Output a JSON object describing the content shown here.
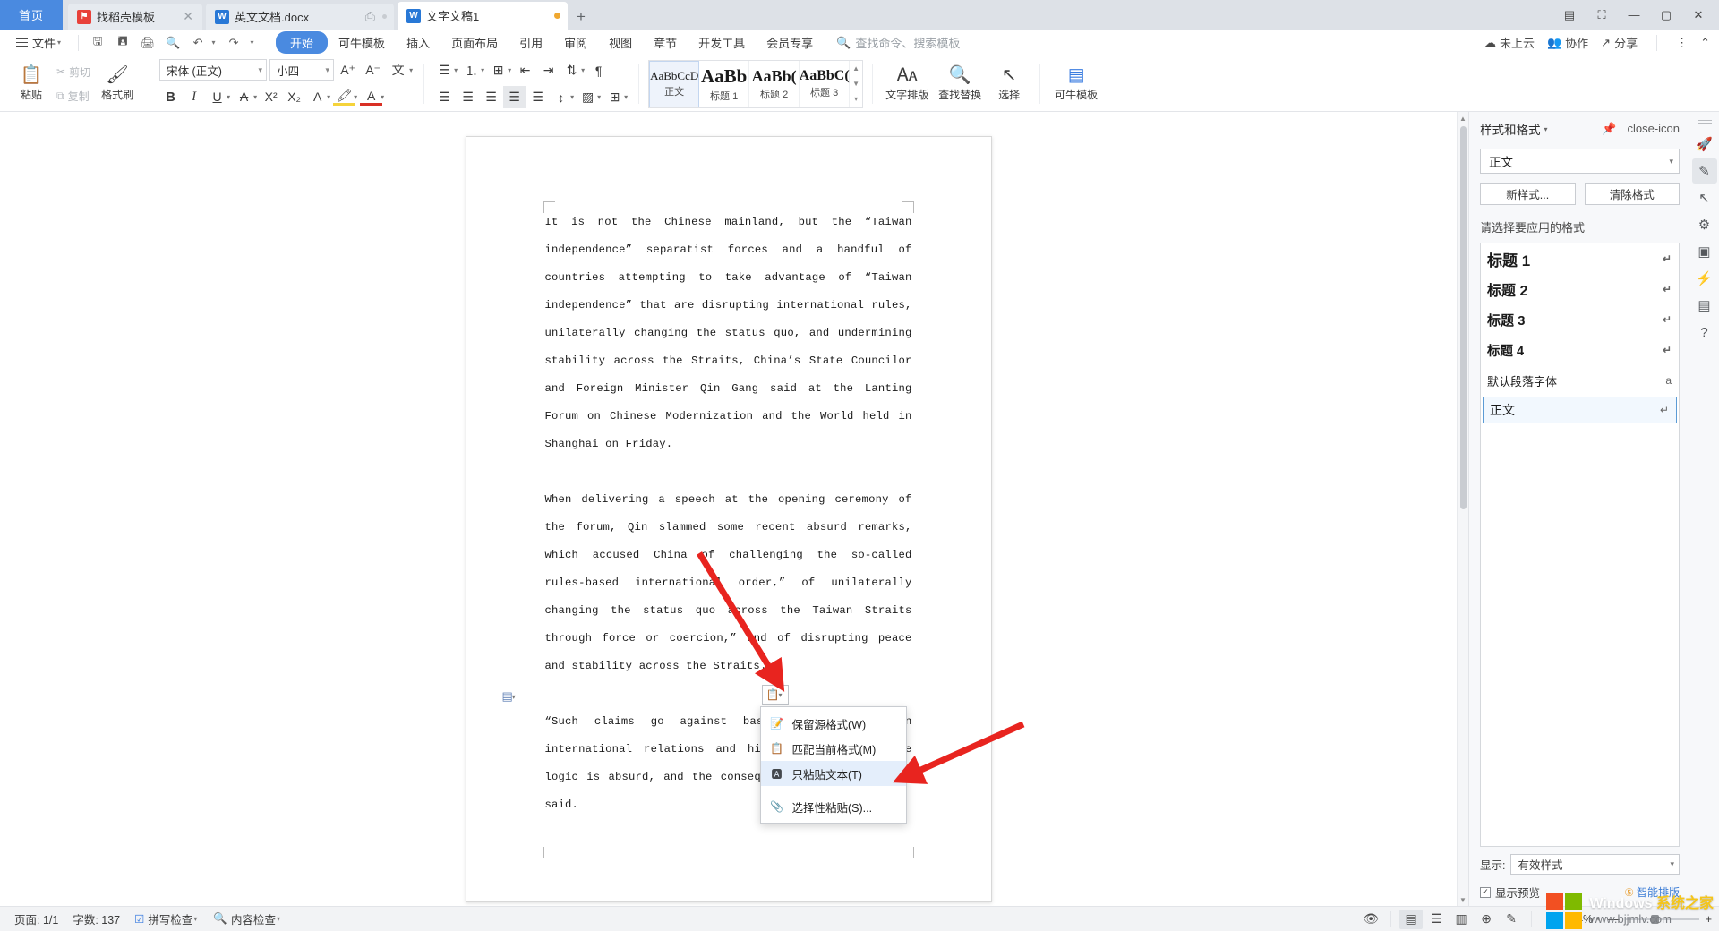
{
  "tabbar": {
    "home_label": "首页",
    "tabs": [
      {
        "label": "找稻壳模板",
        "icon": "kdocs-template-icon",
        "state": "inactive",
        "close": "✕"
      },
      {
        "label": "英文文档.docx",
        "icon": "writer-doc-icon",
        "state": "inactive",
        "close": ""
      },
      {
        "label": "文字文稿1",
        "icon": "writer-doc-icon",
        "state": "active",
        "close": ""
      }
    ],
    "new_tab": "+",
    "window_buttons": [
      "▭",
      "▱",
      "—",
      "▢",
      "✕"
    ]
  },
  "menubar": {
    "file_label": "文件",
    "quick_icons": [
      "save-icon",
      "save-as-icon",
      "print-icon",
      "print-preview-icon",
      "undo-icon",
      "redo-icon",
      "customize-icon"
    ],
    "ribbon_tabs": [
      {
        "label": "开始",
        "active": true
      },
      {
        "label": "可牛模板",
        "active": false
      },
      {
        "label": "插入",
        "active": false
      },
      {
        "label": "页面布局",
        "active": false
      },
      {
        "label": "引用",
        "active": false
      },
      {
        "label": "审阅",
        "active": false
      },
      {
        "label": "视图",
        "active": false
      },
      {
        "label": "章节",
        "active": false
      },
      {
        "label": "开发工具",
        "active": false
      },
      {
        "label": "会员专享",
        "active": false
      }
    ],
    "search_placeholder": "查找命令、搜索模板",
    "right_items": [
      {
        "label": "未上云",
        "icon": "cloud-off-icon"
      },
      {
        "label": "协作",
        "icon": "collaborate-icon"
      },
      {
        "label": "分享",
        "icon": "share-icon"
      }
    ],
    "more_icon": "⋮",
    "collapse_icon": "⌃"
  },
  "toolbar": {
    "paste_label": "粘贴",
    "cut_label": "剪切",
    "copy_label": "复制",
    "format_painter_label": "格式刷",
    "font_name": "宋体 (正文)",
    "font_size": "小四",
    "grow_font_icon": "A⁺",
    "shrink_font_icon": "A⁻",
    "pinyin_icon": "文",
    "clear_format_icon": "⌫",
    "bold": "B",
    "italic": "I",
    "underline": "U",
    "strikethrough": "A",
    "superscript": "X²",
    "subscript": "X₂",
    "char_border": "A",
    "highlight_icon": "highlight-pen-icon",
    "font_color_icon": "font-color-icon",
    "bullets_icon": "bullet-list-icon",
    "numbering_icon": "numbered-list-icon",
    "multilevel_icon": "multilevel-list-icon",
    "dec_indent_icon": "decrease-indent-icon",
    "inc_indent_icon": "increase-indent-icon",
    "sort_icon": "sort-icon",
    "show_marks_icon": "show-paragraph-marks-icon",
    "align_left_icon": "align-left-icon",
    "align_center_icon": "align-center-icon",
    "align_right_icon": "align-right-icon",
    "align_justify_icon": "align-justify-icon",
    "align_distribute_icon": "align-distribute-icon",
    "line_spacing_icon": "line-spacing-icon",
    "shading_icon": "shading-icon",
    "borders_icon": "borders-icon",
    "styles": [
      {
        "preview": "AaBbCcD",
        "name": "正文",
        "selected": true
      },
      {
        "preview": "AaBb",
        "name": "标题 1",
        "selected": false
      },
      {
        "preview": "AaBb(",
        "name": "标题 2",
        "selected": false
      },
      {
        "preview": "AaBbC(",
        "name": "标题 3",
        "selected": false
      }
    ],
    "text_layout_label": "文字排版",
    "find_replace_label": "查找替换",
    "select_label": "选择",
    "keniu_template_label": "可牛模板"
  },
  "document": {
    "paragraphs": [
      "It is not the Chinese mainland, but the “Taiwan independence” separatist forces and a handful of countries attempting to take advantage of “Taiwan independence” that are disrupting international rules, unilaterally changing the status quo, and undermining stability across the Straits, China’s State Councilor and Foreign Minister Qin Gang said at the Lanting Forum on Chinese Modernization and the World held in Shanghai on Friday.",
      "When delivering a speech at the opening ceremony of the forum, Qin slammed some recent absurd remarks, which accused China of challenging the so-called rules-based international order,” of unilaterally changing the status quo across the Taiwan Straits through force or coercion,” and of disrupting peace and stability across the Straits.",
      "“Such claims go against basic common sense on international relations and historical justice. The logic is absurd, and the consequences dangerous,” Qin said."
    ]
  },
  "paste_menu": {
    "button_icon": "paste-options-icon",
    "items": [
      {
        "label": "保留源格式(W)",
        "icon": "keep-source-formatting-icon",
        "highlighted": false
      },
      {
        "label": "匹配当前格式(M)",
        "icon": "match-destination-formatting-icon",
        "highlighted": false
      },
      {
        "label": "只粘贴文本(T)",
        "icon": "keep-text-only-icon",
        "highlighted": true
      },
      {
        "label": "选择性粘贴(S)...",
        "icon": "paste-special-icon",
        "highlighted": false
      }
    ]
  },
  "styles_panel": {
    "title": "样式和格式",
    "pin_icon": "pin-icon",
    "close_icon": "close-icon",
    "current_style": "正文",
    "new_style_btn": "新样式...",
    "clear_format_btn": "清除格式",
    "list_label": "请选择要应用的格式",
    "items": [
      {
        "label": "标题 1",
        "mark": "↵",
        "level": "h1",
        "selected": false
      },
      {
        "label": "标题 2",
        "mark": "↵",
        "level": "h2",
        "selected": false
      },
      {
        "label": "标题 3",
        "mark": "↵",
        "level": "h3",
        "selected": false
      },
      {
        "label": "标题 4",
        "mark": "↵",
        "level": "h4",
        "selected": false
      },
      {
        "label": "默认段落字体",
        "mark": "a",
        "level": "plain",
        "selected": false
      },
      {
        "label": "正文",
        "mark": "↵",
        "level": "plain",
        "selected": true
      }
    ],
    "show_label": "显示:",
    "show_value": "有效样式",
    "preview_label": "显示预览",
    "preview_checked": "✓",
    "smart_layout_label": "智能排版"
  },
  "rail": {
    "icons": [
      {
        "name": "rocket-icon",
        "glyph": "🚀",
        "active": false
      },
      {
        "name": "styles-brush-icon",
        "glyph": "✎",
        "active": true
      },
      {
        "name": "select-pointer-icon",
        "glyph": "↖",
        "active": false
      },
      {
        "name": "settings-sliders-icon",
        "glyph": "⚙",
        "active": false
      },
      {
        "name": "ocr-scan-icon",
        "glyph": "▣",
        "active": false
      },
      {
        "name": "flash-tool-icon",
        "glyph": "⚡",
        "active": false
      },
      {
        "name": "document-check-icon",
        "glyph": "▤",
        "active": false
      },
      {
        "name": "help-icon",
        "glyph": "?",
        "active": false
      }
    ]
  },
  "statusbar": {
    "page_label": "页面: 1/1",
    "word_count_label": "字数: 137",
    "spellcheck_label": "拼写检查",
    "contentcheck_label": "内容检查",
    "eye_icon": "reading-eye-icon",
    "view_icons": [
      {
        "name": "print-layout-view-icon",
        "glyph": "▤",
        "active": true
      },
      {
        "name": "outline-view-icon",
        "glyph": "☰",
        "active": false
      },
      {
        "name": "reading-layout-view-icon",
        "glyph": "▥",
        "active": false
      },
      {
        "name": "web-layout-view-icon",
        "glyph": "⊕",
        "active": false
      },
      {
        "name": "annotation-view-icon",
        "glyph": "✎",
        "active": false
      }
    ],
    "fit_icon": "fit-page-icon",
    "zoom_value": "74%",
    "zoom_out": "—",
    "zoom_in": "+"
  },
  "watermark": {
    "title_prefix": "Windows ",
    "title_suffix": "系统之家",
    "url": "www.bjjmlv.com",
    "logo_colors": [
      "#f25022",
      "#7fba00",
      "#00a4ef",
      "#ffb900"
    ]
  },
  "colors": {
    "accent": "#4a8ae0",
    "tabbar_bg": "#dde1e7",
    "arrow_red": "#e8241f",
    "highlight_blue": "#e4eefb"
  }
}
